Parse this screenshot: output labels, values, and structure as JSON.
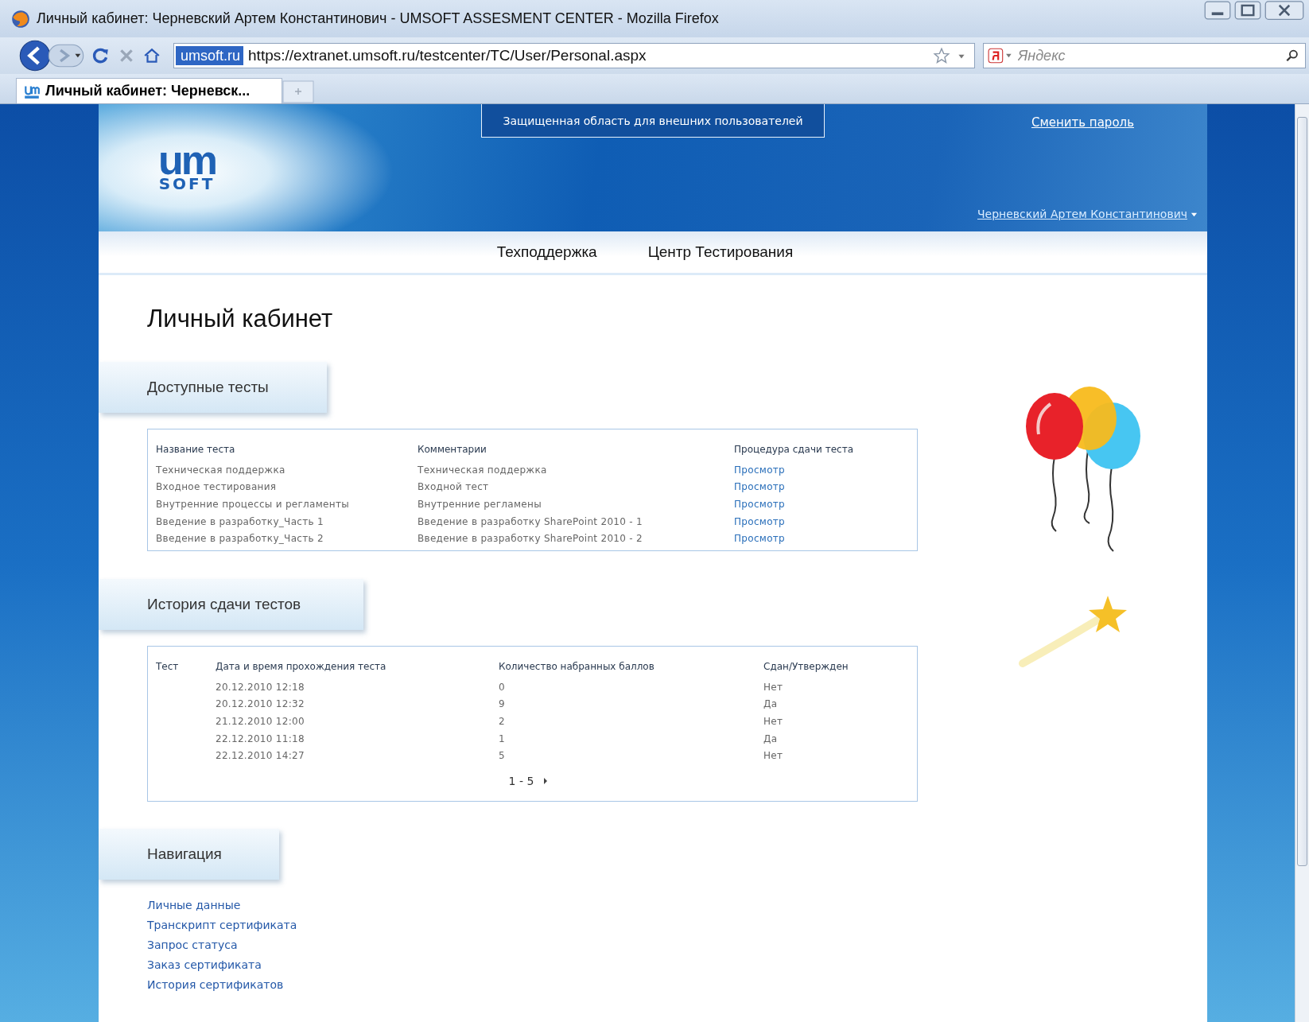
{
  "window": {
    "title": "Личный кабинет: Черневский Артем Константинович - UMSOFT ASSESMENT CENTER - Mozilla Firefox"
  },
  "toolbar": {
    "site_badge": "umsoft.ru",
    "url": "https://extranet.umsoft.ru/testcenter/TC/User/Personal.aspx",
    "search_placeholder": "Яндекс"
  },
  "tabs": [
    {
      "label": "Личный кабинет: Черневск...",
      "selected": true
    }
  ],
  "header": {
    "banner": "Защищенная область для внешних пользователей",
    "change_password": "Сменить пароль",
    "logo_mark": "um",
    "logo_word": "SOFT",
    "user": "Черневский Артем Константинович"
  },
  "menu": [
    "Техподдержка",
    "Центр Тестирования"
  ],
  "page_title": "Личный кабинет",
  "available_tests": {
    "title": "Доступные тесты",
    "columns": [
      "Название теста",
      "Комментарии",
      "Процедура сдачи теста"
    ],
    "rows": [
      {
        "name": "Техническая поддержка",
        "comment": "Техническая поддержка",
        "action": "Просмотр"
      },
      {
        "name": "Входное тестирования",
        "comment": "Входной тест",
        "action": "Просмотр"
      },
      {
        "name": "Внутренние процессы и регламенты",
        "comment": "Внутренние регламены",
        "action": "Просмотр"
      },
      {
        "name": "Введение в разработку_Часть 1",
        "comment": "Введение в разработку SharePoint 2010 - 1",
        "action": "Просмотр"
      },
      {
        "name": "Введение в разработку_Часть 2",
        "comment": "Введение в разработку SharePoint 2010 - 2",
        "action": "Просмотр"
      }
    ]
  },
  "history": {
    "title": "История сдачи тестов",
    "columns": [
      "Тест",
      "Дата и время прохождения теста",
      "Количество набранных баллов",
      "Сдан/Утвержден"
    ],
    "rows": [
      {
        "date": "20.12.2010 12:18",
        "score": "0",
        "passed": "Нет"
      },
      {
        "date": "20.12.2010 12:32",
        "score": "9",
        "passed": "Да"
      },
      {
        "date": "21.12.2010 12:00",
        "score": "2",
        "passed": "Нет"
      },
      {
        "date": "22.12.2010 11:18",
        "score": "1",
        "passed": "Да"
      },
      {
        "date": "22.12.2010 14:27",
        "score": "5",
        "passed": "Нет"
      }
    ],
    "pager": "1 - 5"
  },
  "navigation": {
    "title": "Навигация",
    "links": [
      "Личные данные",
      "Транскрипт сертификата",
      "Запрос статуса",
      "Заказ сертификата",
      "История сертификатов"
    ]
  }
}
